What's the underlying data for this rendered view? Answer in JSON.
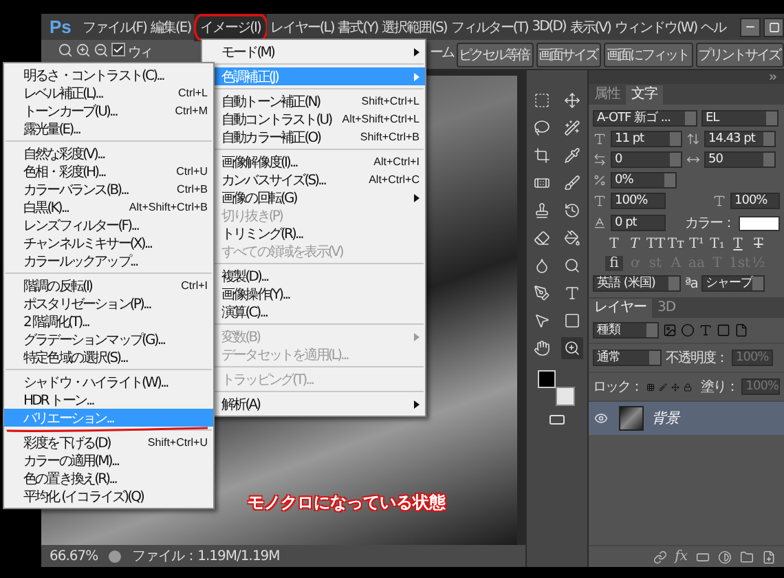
{
  "app": {
    "logo": "Ps"
  },
  "menubar": [
    {
      "label": "ファイル(F)",
      "selected": false
    },
    {
      "label": "編集(E)",
      "selected": false
    },
    {
      "label": "イメージ(I)",
      "selected": true,
      "circled": true
    },
    {
      "label": "レイヤー(L)",
      "selected": false
    },
    {
      "label": "書式(Y)",
      "selected": false
    },
    {
      "label": "選択範囲(S)",
      "selected": false
    },
    {
      "label": "フィルター(T)",
      "selected": false
    },
    {
      "label": "3D(D)",
      "selected": false
    },
    {
      "label": "表示(V)",
      "selected": false
    },
    {
      "label": "ウィンドウ(W)",
      "selected": false
    },
    {
      "label": "ヘル",
      "selected": false
    }
  ],
  "options_bar": {
    "all_windows": {
      "label": "ウィ",
      "checked": true
    },
    "cut_text": "ーム",
    "buttons": [
      "ピクセル等倍",
      "画面サイズ",
      "画面にフィット",
      "プリントサイズ"
    ]
  },
  "image_menu": [
    {
      "kind": "item",
      "label": "モード(M)",
      "submenu": true,
      "selected": false,
      "disabled": false
    },
    {
      "kind": "separator"
    },
    {
      "kind": "item",
      "label": "色調補正(J)",
      "submenu": true,
      "selected": true,
      "disabled": false
    },
    {
      "kind": "separator"
    },
    {
      "kind": "item",
      "label": "自動トーン補正(N)",
      "shortcut": "Shift+Ctrl+L",
      "selected": false,
      "disabled": false
    },
    {
      "kind": "item",
      "label": "自動コントラスト(U)",
      "shortcut": "Alt+Shift+Ctrl+L",
      "selected": false,
      "disabled": false
    },
    {
      "kind": "item",
      "label": "自動カラー補正(O)",
      "shortcut": "Shift+Ctrl+B",
      "selected": false,
      "disabled": false
    },
    {
      "kind": "separator"
    },
    {
      "kind": "item",
      "label": "画像解像度(I)...",
      "shortcut": "Alt+Ctrl+I",
      "selected": false,
      "disabled": false
    },
    {
      "kind": "item",
      "label": "カンバスサイズ(S)...",
      "shortcut": "Alt+Ctrl+C",
      "selected": false,
      "disabled": false
    },
    {
      "kind": "item",
      "label": "画像の回転(G)",
      "submenu": true,
      "selected": false,
      "disabled": false
    },
    {
      "kind": "item",
      "label": "切り抜き(P)",
      "selected": false,
      "disabled": true
    },
    {
      "kind": "item",
      "label": "トリミング(R)...",
      "selected": false,
      "disabled": false
    },
    {
      "kind": "item",
      "label": "すべての領域を表示(V)",
      "selected": false,
      "disabled": true
    },
    {
      "kind": "separator"
    },
    {
      "kind": "item",
      "label": "複製(D)...",
      "selected": false,
      "disabled": false
    },
    {
      "kind": "item",
      "label": "画像操作(Y)...",
      "selected": false,
      "disabled": false
    },
    {
      "kind": "item",
      "label": "演算(C)...",
      "selected": false,
      "disabled": false
    },
    {
      "kind": "separator"
    },
    {
      "kind": "item",
      "label": "変数(B)",
      "submenu": true,
      "selected": false,
      "disabled": true
    },
    {
      "kind": "item",
      "label": "データセットを適用(L)...",
      "selected": false,
      "disabled": true
    },
    {
      "kind": "separator"
    },
    {
      "kind": "item",
      "label": "トラッピング(T)...",
      "selected": false,
      "disabled": true
    },
    {
      "kind": "separator"
    },
    {
      "kind": "item",
      "label": "解析(A)",
      "submenu": true,
      "selected": false,
      "disabled": false
    }
  ],
  "adjustments_menu": [
    {
      "kind": "item",
      "label": "明るさ・コントラスト(C)...",
      "selected": false,
      "disabled": false
    },
    {
      "kind": "item",
      "label": "レベル補正(L)...",
      "shortcut": "Ctrl+L",
      "selected": false,
      "disabled": false
    },
    {
      "kind": "item",
      "label": "トーンカーブ(U)...",
      "shortcut": "Ctrl+M",
      "selected": false,
      "disabled": false
    },
    {
      "kind": "item",
      "label": "露光量(E)...",
      "selected": false,
      "disabled": false
    },
    {
      "kind": "separator"
    },
    {
      "kind": "item",
      "label": "自然な彩度(V)...",
      "selected": false,
      "disabled": false
    },
    {
      "kind": "item",
      "label": "色相・彩度(H)...",
      "shortcut": "Ctrl+U",
      "selected": false,
      "disabled": false
    },
    {
      "kind": "item",
      "label": "カラーバランス(B)...",
      "shortcut": "Ctrl+B",
      "selected": false,
      "disabled": false
    },
    {
      "kind": "item",
      "label": "白黒(K)...",
      "shortcut": "Alt+Shift+Ctrl+B",
      "selected": false,
      "disabled": false
    },
    {
      "kind": "item",
      "label": "レンズフィルター(F)...",
      "selected": false,
      "disabled": false
    },
    {
      "kind": "item",
      "label": "チャンネルミキサー(X)...",
      "selected": false,
      "disabled": false
    },
    {
      "kind": "item",
      "label": "カラールックアップ...",
      "selected": false,
      "disabled": false
    },
    {
      "kind": "separator"
    },
    {
      "kind": "item",
      "label": "階調の反転(I)",
      "shortcut": "Ctrl+I",
      "selected": false,
      "disabled": false
    },
    {
      "kind": "item",
      "label": "ポスタリゼーション(P)...",
      "selected": false,
      "disabled": false
    },
    {
      "kind": "item",
      "label": "2 階調化(T)...",
      "selected": false,
      "disabled": false
    },
    {
      "kind": "item",
      "label": "グラデーションマップ(G)...",
      "selected": false,
      "disabled": false
    },
    {
      "kind": "item",
      "label": "特定色域の選択(S)...",
      "selected": false,
      "disabled": false
    },
    {
      "kind": "separator"
    },
    {
      "kind": "item",
      "label": "シャドウ・ハイライト(W)...",
      "selected": false,
      "disabled": false
    },
    {
      "kind": "item",
      "label": "HDR トーン...",
      "selected": false,
      "disabled": false
    },
    {
      "kind": "item",
      "label": "バリエーション...",
      "selected": true,
      "disabled": false,
      "underlined": true
    },
    {
      "kind": "separator"
    },
    {
      "kind": "item",
      "label": "彩度を下げる(D)",
      "shortcut": "Shift+Ctrl+U",
      "selected": false,
      "disabled": false
    },
    {
      "kind": "item",
      "label": "カラーの適用(M)...",
      "selected": false,
      "disabled": false
    },
    {
      "kind": "item",
      "label": "色の置き換え(R)...",
      "selected": false,
      "disabled": false
    },
    {
      "kind": "item",
      "label": "平均化 (イコライズ)(Q)",
      "selected": false,
      "disabled": false
    }
  ],
  "document": {
    "caption": "モノクロになっている状態",
    "zoom": "66.67%",
    "file_info": "ファイル：1.19M/1.19M"
  },
  "character_panel": {
    "tabs": [
      {
        "label": "属性",
        "selected": false
      },
      {
        "label": "文字",
        "selected": true
      }
    ],
    "font_family": "A-OTF 新ゴ ...",
    "font_style": "EL",
    "font_size": "11 pt",
    "leading": "14.43 pt",
    "kerning": "0",
    "tracking": "50",
    "tsume": "0%",
    "vertical_scale": "100%",
    "horizontal_scale": "100%",
    "baseline_shift": "0 pt",
    "color_label": "カラー：",
    "style_buttons": [
      {
        "label": "T",
        "kind": "regular"
      },
      {
        "label": "T",
        "kind": "italic"
      },
      {
        "label": "TT",
        "kind": "regular"
      },
      {
        "label": "Tт",
        "kind": "regular"
      },
      {
        "label": "T¹",
        "kind": "regular"
      },
      {
        "label": "T₁",
        "kind": "regular"
      },
      {
        "label": "T",
        "kind": "underline"
      },
      {
        "label": "T",
        "kind": "strike"
      }
    ],
    "opentype_buttons": [
      {
        "label": "fi",
        "disabled": false
      },
      {
        "label": "ơ",
        "disabled": true
      },
      {
        "label": "st",
        "disabled": true
      },
      {
        "label": "A",
        "disabled": true
      },
      {
        "label": "aa",
        "disabled": true
      },
      {
        "label": "T",
        "disabled": true
      },
      {
        "label": "1st",
        "disabled": true
      },
      {
        "label": "½",
        "disabled": true
      }
    ],
    "language": "英語 (米国)",
    "aa_label": "ªa",
    "antialias": "シャープ"
  },
  "layers_panel": {
    "tabs": [
      {
        "label": "レイヤー",
        "selected": true
      },
      {
        "label": "3D",
        "selected": false
      }
    ],
    "filter": "種類",
    "blend_mode": "通常",
    "opacity_label": "不透明度：",
    "opacity": "100%",
    "lock_label": "ロック：",
    "fill_label": "塗り：",
    "fill": "100%",
    "fx_label": "fx",
    "layers": [
      {
        "name": "背景",
        "visible": true,
        "selected": true
      }
    ]
  }
}
